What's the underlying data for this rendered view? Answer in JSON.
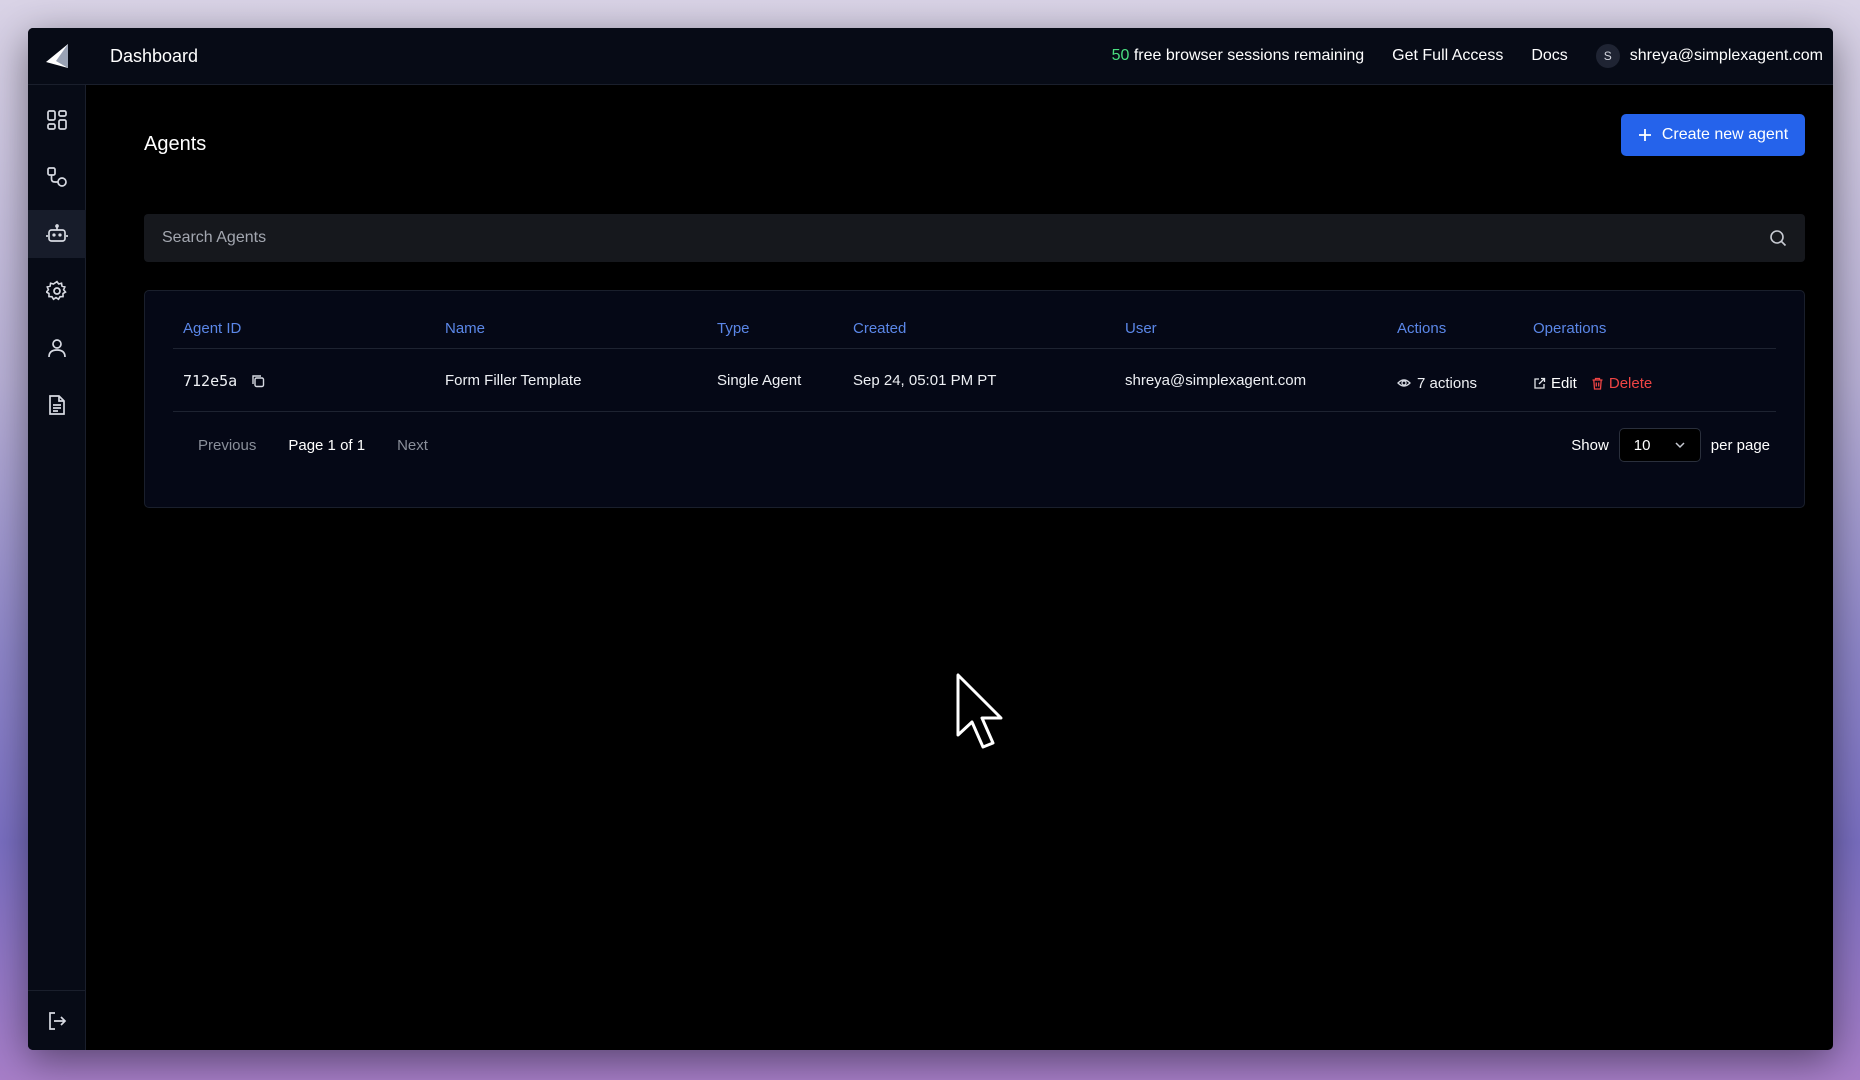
{
  "topbar": {
    "title": "Dashboard",
    "sessions_count": "50",
    "sessions_text": " free browser sessions remaining",
    "full_access": "Get Full Access",
    "docs": "Docs",
    "user_initial": "S",
    "user_email": "shreya@simplexagent.com"
  },
  "sidebar": {
    "items": [
      {
        "icon": "dashboard-grid-icon"
      },
      {
        "icon": "workflow-icon"
      },
      {
        "icon": "robot-icon",
        "active": true
      },
      {
        "icon": "gear-icon"
      },
      {
        "icon": "user-icon"
      },
      {
        "icon": "document-icon"
      }
    ],
    "bottom": {
      "icon": "logout-icon"
    }
  },
  "main": {
    "title": "Agents",
    "create_button": "Create new agent",
    "search_placeholder": "Search Agents"
  },
  "table": {
    "headers": [
      "Agent ID",
      "Name",
      "Type",
      "Created",
      "User",
      "Actions",
      "Operations"
    ],
    "rows": [
      {
        "agent_id": "712e5a",
        "name": "Form Filler Template",
        "type": "Single Agent",
        "created": "Sep 24, 05:01 PM PT",
        "user": "shreya@simplexagent.com",
        "actions": "7 actions",
        "edit": "Edit",
        "delete": "Delete"
      }
    ]
  },
  "pagination": {
    "previous": "Previous",
    "page_info": "Page 1 of 1",
    "next": "Next",
    "show": "Show",
    "per_page_value": "10",
    "per_page": "per page"
  },
  "colors": {
    "accent": "#2563eb",
    "header_text": "#5b87e8",
    "sessions_count": "#4ade80",
    "delete": "#ef4444"
  }
}
